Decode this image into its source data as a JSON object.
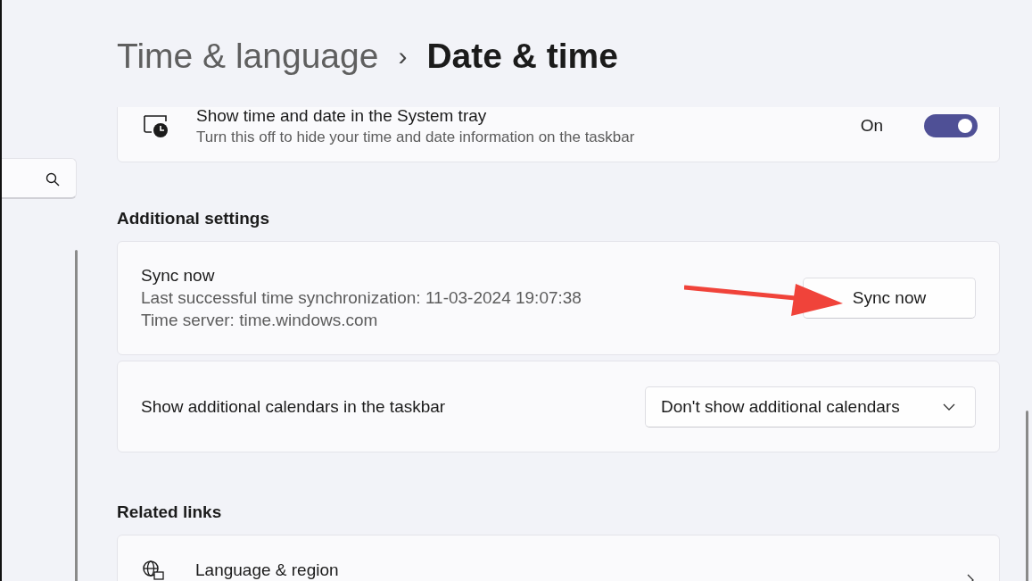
{
  "breadcrumb": {
    "parent": "Time & language",
    "separator": "›",
    "current": "Date & time"
  },
  "tray_setting": {
    "title": "Show time and date in the System tray",
    "description": "Turn this off to hide your time and date information on the taskbar",
    "state_label": "On",
    "on": true
  },
  "additional_settings": {
    "heading": "Additional settings",
    "sync": {
      "title": "Sync now",
      "last_sync": "Last successful time synchronization: 11-03-2024 19:07:38",
      "server": "Time server: time.windows.com",
      "button": "Sync now"
    },
    "calendars": {
      "label": "Show additional calendars in the taskbar",
      "value": "Don't show additional calendars"
    }
  },
  "related_links": {
    "heading": "Related links",
    "items": [
      {
        "label": "Language & region"
      }
    ]
  }
}
